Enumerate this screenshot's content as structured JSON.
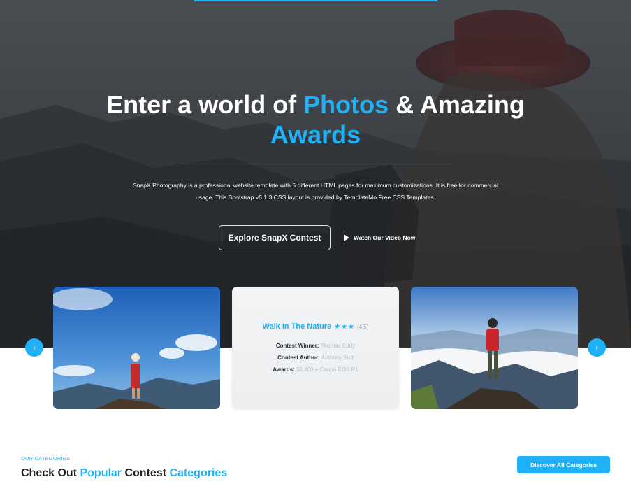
{
  "hero": {
    "title_part1": "Enter a world of ",
    "title_accent1": "Photos",
    "title_part2": " & Amazing",
    "title_accent2": "Awards",
    "description_line1": "SnapX Photography is a professional website template with 5 different HTML pages for maximum customizations. It is free for commercial",
    "description_line2": "usage. This Bootstrap v5.1.3 CSS layout is provided by TemplateMo Free CSS Templates.",
    "primary_button": "Explore SnapX Contest",
    "video_link": "Watch Our Video Now"
  },
  "carousel": {
    "prev_icon": "‹",
    "next_icon": "›",
    "featured": {
      "title": "Walk In The Nature",
      "stars": "★★★",
      "rating": "(4.5)",
      "winner_label": "Contest Winner:",
      "winner_value": "Thomas Eddy",
      "author_label": "Contest Author:",
      "author_value": "Anthony Soft",
      "awards_label": "Awards:",
      "awards_value": "$8,400 + Canon EOS R1"
    }
  },
  "categories": {
    "subtitle": "OUR CATEGORIES",
    "title_part1": "Check Out ",
    "title_accent1": "Popular",
    "title_part2": " Contest ",
    "title_accent2": "Categories",
    "button": "Discover All Categories"
  },
  "colors": {
    "accent": "#1fb0f5",
    "dark_text": "#1e2226"
  },
  "icons": [
    "play-icon",
    "chevron-left-icon",
    "chevron-right-icon",
    "star-icon"
  ]
}
